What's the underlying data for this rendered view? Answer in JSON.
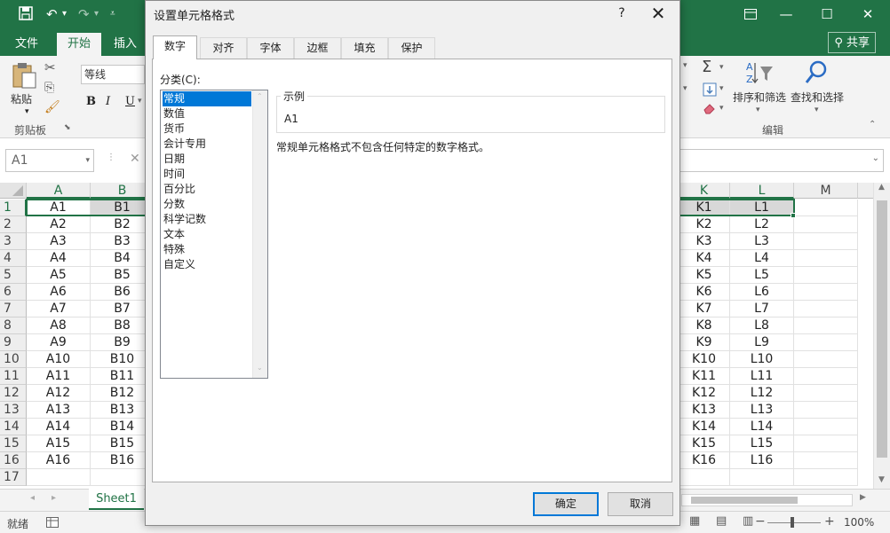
{
  "titlebar": {
    "save_icon": "save-icon",
    "undo_icon": "undo-icon",
    "redo_icon": "redo-icon",
    "customize_icon": "customize-qat-icon",
    "minimize_glyph": "—",
    "maximize_glyph": "☐",
    "close_glyph": "✕"
  },
  "ribbon": {
    "tabs": [
      {
        "label": "文件"
      },
      {
        "label": "开始"
      },
      {
        "label": "插入"
      }
    ],
    "share_label": "共享",
    "clipboard": {
      "paste_label": "粘贴",
      "group_label": "剪贴板"
    },
    "font": {
      "font_name": "等线",
      "bold": "B",
      "italic": "I",
      "underline": "U"
    },
    "editing": {
      "sort_filter_label": "排序和筛选",
      "find_select_label": "查找和选择",
      "group_label": "编辑"
    }
  },
  "formula_bar": {
    "name_box": "A1"
  },
  "grid": {
    "columns": [
      "A",
      "B",
      "K",
      "L",
      "M"
    ],
    "rows": [
      {
        "num": "1",
        "a": "A1",
        "b": "B1",
        "k": "K1",
        "l": "L1"
      },
      {
        "num": "2",
        "a": "A2",
        "b": "B2",
        "k": "K2",
        "l": "L2"
      },
      {
        "num": "3",
        "a": "A3",
        "b": "B3",
        "k": "K3",
        "l": "L3"
      },
      {
        "num": "4",
        "a": "A4",
        "b": "B4",
        "k": "K4",
        "l": "L4"
      },
      {
        "num": "5",
        "a": "A5",
        "b": "B5",
        "k": "K5",
        "l": "L5"
      },
      {
        "num": "6",
        "a": "A6",
        "b": "B6",
        "k": "K6",
        "l": "L6"
      },
      {
        "num": "7",
        "a": "A7",
        "b": "B7",
        "k": "K7",
        "l": "L7"
      },
      {
        "num": "8",
        "a": "A8",
        "b": "B8",
        "k": "K8",
        "l": "L8"
      },
      {
        "num": "9",
        "a": "A9",
        "b": "B9",
        "k": "K9",
        "l": "L9"
      },
      {
        "num": "10",
        "a": "A10",
        "b": "B10",
        "k": "K10",
        "l": "L10"
      },
      {
        "num": "11",
        "a": "A11",
        "b": "B11",
        "k": "K11",
        "l": "L11"
      },
      {
        "num": "12",
        "a": "A12",
        "b": "B12",
        "k": "K12",
        "l": "L12"
      },
      {
        "num": "13",
        "a": "A13",
        "b": "B13",
        "k": "K13",
        "l": "L13"
      },
      {
        "num": "14",
        "a": "A14",
        "b": "B14",
        "k": "K14",
        "l": "L14"
      },
      {
        "num": "15",
        "a": "A15",
        "b": "B15",
        "k": "K15",
        "l": "L15"
      },
      {
        "num": "16",
        "a": "A16",
        "b": "B16",
        "k": "K16",
        "l": "L16"
      },
      {
        "num": "17",
        "a": "",
        "b": "",
        "k": "",
        "l": ""
      }
    ]
  },
  "sheets": {
    "active": "Sheet1"
  },
  "status": {
    "ready": "就绪",
    "zoom": "100%"
  },
  "dialog": {
    "title": "设置单元格格式",
    "help": "?",
    "close": "✕",
    "tabs": [
      "数字",
      "对齐",
      "字体",
      "边框",
      "填充",
      "保护"
    ],
    "category_label": "分类(C):",
    "categories": [
      "常规",
      "数值",
      "货币",
      "会计专用",
      "日期",
      "时间",
      "百分比",
      "分数",
      "科学记数",
      "文本",
      "特殊",
      "自定义"
    ],
    "selected_category": "常规",
    "sample_legend": "示例",
    "sample_value": "A1",
    "description": "常规单元格格式不包含任何特定的数字格式。",
    "ok_label": "确定",
    "cancel_label": "取消"
  },
  "colors": {
    "excel_green": "#217346",
    "selection_blue": "#0078d7"
  }
}
